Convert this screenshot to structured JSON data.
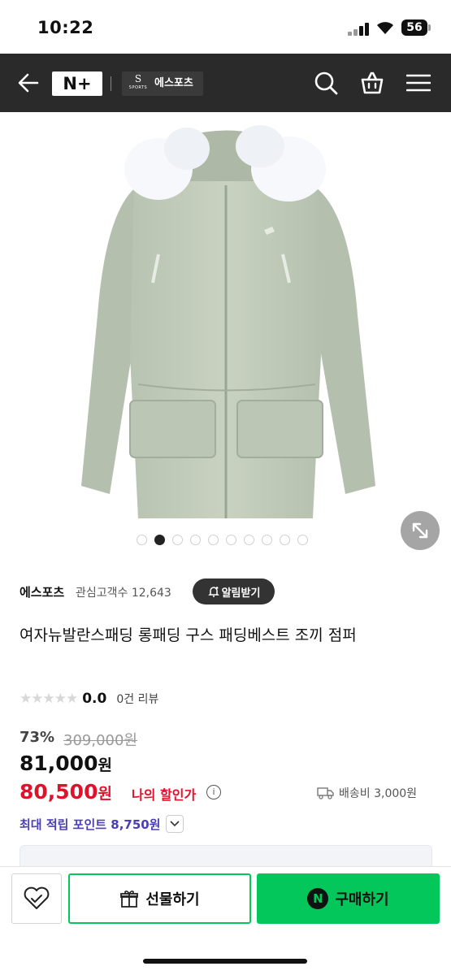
{
  "status_bar": {
    "time": "10:22",
    "battery": "56"
  },
  "header": {
    "brand": "N+",
    "store_logo_big": "S",
    "store_logo_small": "SPORTS",
    "store_name": "에스포츠"
  },
  "gallery": {
    "image_count": 10,
    "active_index": 1
  },
  "product": {
    "seller": "에스포츠",
    "followers": "관심고객수 12,643",
    "notify_label": "알림받기",
    "title": "여자뉴발란스패딩 롱패딩 구스 패딩베스트 조끼 점퍼",
    "rating": "0.0",
    "reviews": "0건 리뷰",
    "discount": "73%",
    "original_price": "309,000원",
    "price_value": "81,000",
    "price_unit": "원",
    "my_price_value": "80,500",
    "my_price_unit": "원",
    "my_price_label": "나의 할인가",
    "shipping": "배송비 3,000원",
    "points": "최대 적립 포인트 8,750원"
  },
  "bottom_bar": {
    "gift_label": "선물하기",
    "buy_label": "구매하기",
    "buy_badge": "N"
  },
  "colors": {
    "naver_green": "#03c75a",
    "discount_red": "#e0112a",
    "points_purple": "#4a3fb5"
  }
}
